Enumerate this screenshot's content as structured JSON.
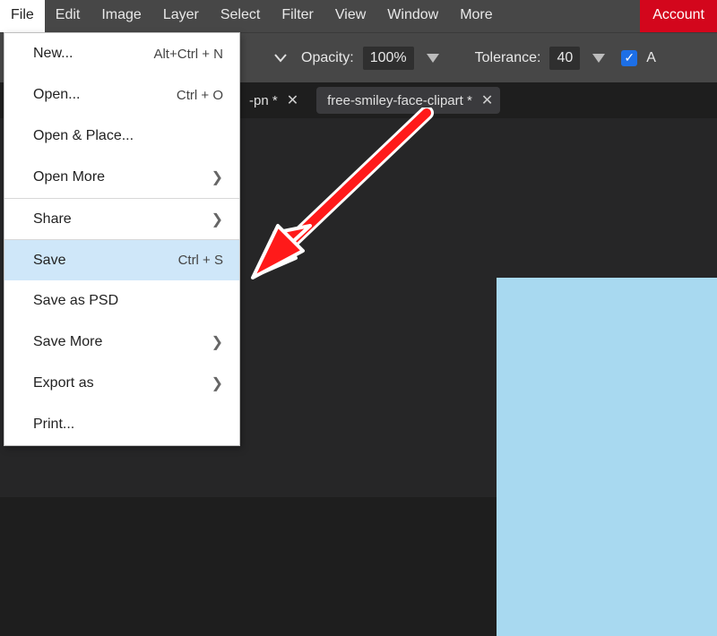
{
  "menubar": {
    "items": [
      "File",
      "Edit",
      "Image",
      "Layer",
      "Select",
      "Filter",
      "View",
      "Window",
      "More"
    ],
    "account_label": "Account"
  },
  "options": {
    "opacity_label": "Opacity:",
    "opacity_value": "100%",
    "tolerance_label": "Tolerance:",
    "tolerance_value": "40",
    "trailing_text": "A"
  },
  "tabs": [
    {
      "label": "-pn *",
      "active": false
    },
    {
      "label": "free-smiley-face-clipart *",
      "active": true
    }
  ],
  "file_menu": [
    {
      "label": "New...",
      "shortcut": "Alt+Ctrl + N",
      "submenu": false,
      "sep": false,
      "highlight": false
    },
    {
      "label": "Open...",
      "shortcut": "Ctrl + O",
      "submenu": false,
      "sep": false,
      "highlight": false
    },
    {
      "label": "Open & Place...",
      "shortcut": "",
      "submenu": false,
      "sep": false,
      "highlight": false
    },
    {
      "label": "Open More",
      "shortcut": "",
      "submenu": true,
      "sep": false,
      "highlight": false
    },
    {
      "label": "Share",
      "shortcut": "",
      "submenu": true,
      "sep": true,
      "highlight": false
    },
    {
      "label": "Save",
      "shortcut": "Ctrl + S",
      "submenu": false,
      "sep": true,
      "highlight": true
    },
    {
      "label": "Save as PSD",
      "shortcut": "",
      "submenu": false,
      "sep": false,
      "highlight": false
    },
    {
      "label": "Save More",
      "shortcut": "",
      "submenu": true,
      "sep": false,
      "highlight": false
    },
    {
      "label": "Export as",
      "shortcut": "",
      "submenu": true,
      "sep": false,
      "highlight": false
    },
    {
      "label": "Print...",
      "shortcut": "",
      "submenu": false,
      "sep": false,
      "highlight": false
    }
  ],
  "colors": {
    "accent_red": "#d3061c",
    "highlight": "#cfe7f9",
    "canvas": "#a8d9f0"
  }
}
